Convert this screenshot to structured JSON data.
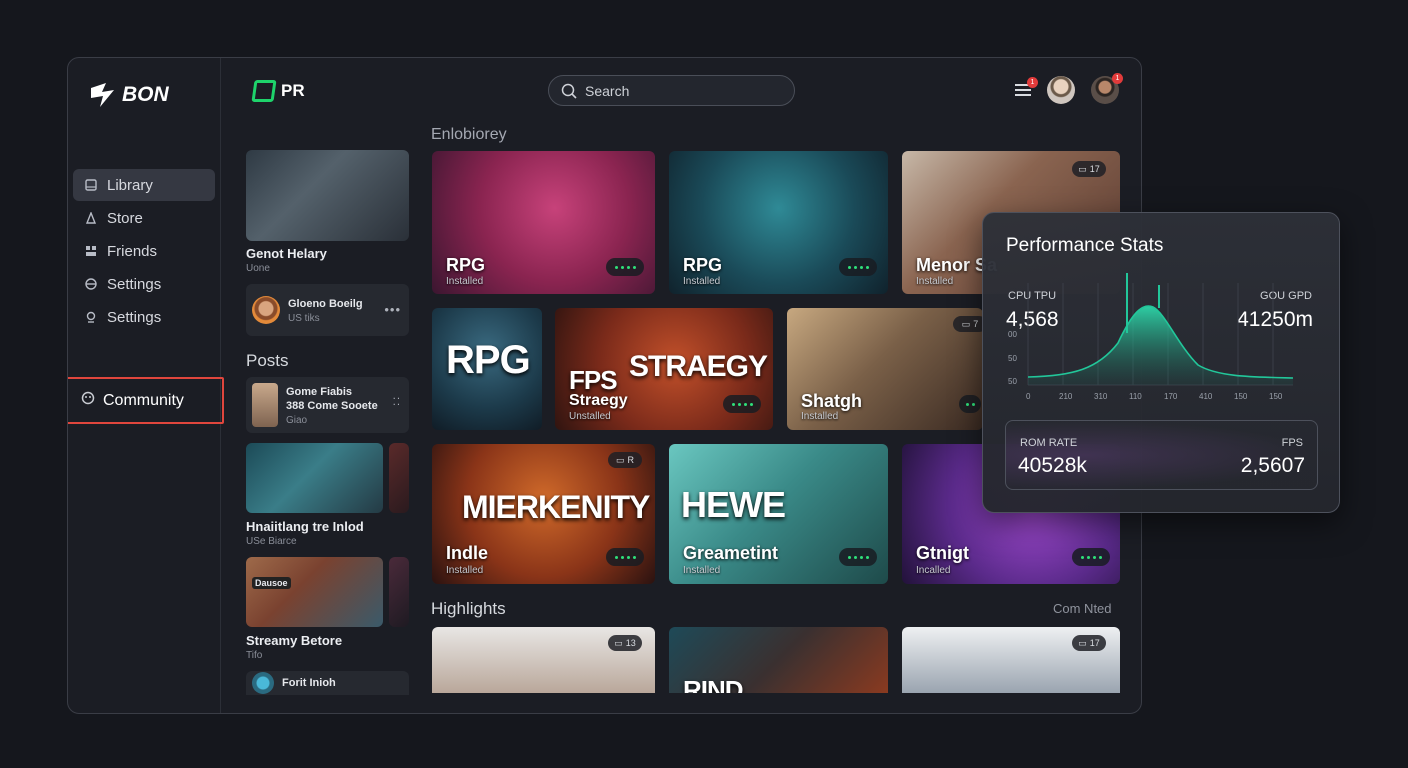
{
  "sidebar": {
    "brand": "BON",
    "nav": [
      {
        "label": "Library",
        "icon": "library-icon"
      },
      {
        "label": "Store",
        "icon": "store-icon"
      },
      {
        "label": "Friends",
        "icon": "friends-icon"
      },
      {
        "label": "Settings",
        "icon": "settings-icon"
      },
      {
        "label": "Settings",
        "icon": "settings-icon-2"
      }
    ],
    "community": "Community"
  },
  "topbar": {
    "logo": "PR",
    "search_placeholder": "Search",
    "notification_count": "1",
    "profile_notification": "1"
  },
  "left_column": {
    "featured": {
      "title": "Genot Helary",
      "sub": "Uone"
    },
    "featured_post": {
      "title": "Gloeno Boeilg",
      "sub": "US tiks"
    },
    "posts_label": "Posts",
    "post": {
      "line1": "Gome Fiabis",
      "line2": "388 Come Sooete",
      "sub": "Giao"
    },
    "card1": {
      "title": "Hnaiitlang tre Inlod",
      "sub": "USe Biarce"
    },
    "card2": {
      "title": "Streamy Betore",
      "sub": "Tifo",
      "badge": "Dausoe"
    },
    "card3": {
      "title": "Forit Inioh"
    }
  },
  "main": {
    "section_label": "Enlobiorey",
    "highlights_label": "Highlights",
    "highlights_link": "Com Nted",
    "tiles": [
      {
        "genre": "RPG",
        "status": "Installed"
      },
      {
        "genre": "RPG",
        "status": "Installed"
      },
      {
        "genre": "Menor Sa",
        "status": "Installed",
        "badge": "17"
      },
      {
        "big": "RPG"
      },
      {
        "big1": "FPS",
        "big2": "STRAEGY",
        "genre": "Straegy",
        "status": "Unstalled"
      },
      {
        "genre": "Shatgh",
        "status": "Installed",
        "badge": "7"
      },
      {
        "big": "MIERKENITY",
        "genre": "Indle",
        "status": "Installed",
        "badge": "R"
      },
      {
        "big": "HEWE",
        "genre": "Greametint",
        "status": "Installed"
      },
      {
        "genre": "Gtnigt",
        "status": "Incalled"
      },
      {
        "badge": "13"
      },
      {
        "big": "RIND"
      },
      {
        "badge": "17"
      }
    ]
  },
  "performance": {
    "title": "Performance Stats",
    "cpu_label": "CPU TPU",
    "cpu_value": "4,568",
    "gpu_label": "GOU GPD",
    "gpu_value": "41250m",
    "rom_label": "ROM RATE",
    "rom_value": "40528k",
    "fps_label": "FPS",
    "fps_value": "2,5607",
    "y_ticks": [
      "00",
      "50",
      "50"
    ],
    "x_ticks": [
      "0",
      "210",
      "310",
      "110",
      "170",
      "410",
      "150",
      "150"
    ],
    "accent": "#22c79a"
  }
}
